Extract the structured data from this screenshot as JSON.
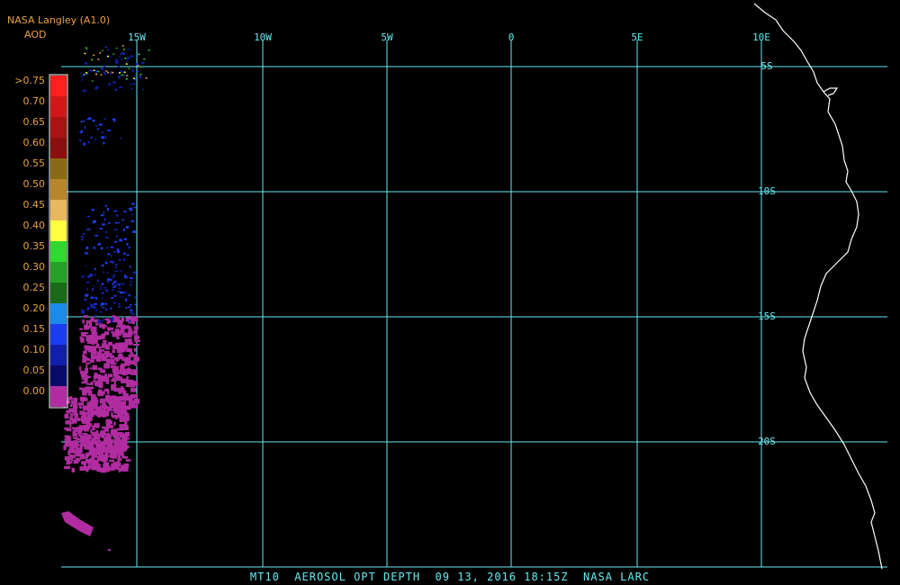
{
  "header": {
    "source": "NASA Langley (A1.0)",
    "product": "AOD"
  },
  "legend": {
    "labels": [
      ">0.75",
      "0.70",
      "0.65",
      "0.60",
      "0.55",
      "0.50",
      "0.45",
      "0.40",
      "0.35",
      "0.30",
      "0.25",
      "0.20",
      "0.15",
      "0.10",
      "0.05",
      "0.00"
    ],
    "colors": [
      "#ff1f1f",
      "#d01818",
      "#a81414",
      "#8a1010",
      "#8a6a14",
      "#b8862a",
      "#e8b860",
      "#ffff40",
      "#30d830",
      "#28a028",
      "#1a6a1a",
      "#1e8ae8",
      "#1c3cf0",
      "#1020a8",
      "#0a0a6a",
      "#b02ca0"
    ]
  },
  "axes": {
    "longitude_labels": [
      "15W",
      "10W",
      "5W",
      "0",
      "5E",
      "10E"
    ],
    "latitude_labels": [
      "5S",
      "10S",
      "15S",
      "20S"
    ],
    "grid_color": "#66e8f0",
    "coast_color": "#ffffff"
  },
  "footer": {
    "caption": "MT10  AEROSOL OPT DEPTH  09 13, 2016 18:15Z  NASA LARC"
  }
}
